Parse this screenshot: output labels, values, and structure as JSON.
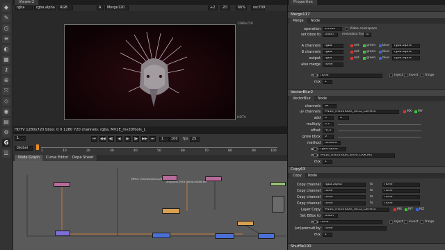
{
  "viewer": {
    "tab": "Viewer2",
    "channels": "rgba",
    "layer": "rgba.alpha",
    "colorspace": "RGB",
    "input_a": "A",
    "input_a_node": "Merge120",
    "gain": "+2",
    "mode": "2D",
    "zoom": "66%",
    "frame_cmp": "rec709",
    "pos_a": "0.5",
    "pos_b": "1",
    "format_label": "1280x720",
    "hdtv_label": "HDTV",
    "info": "HDTV 1280x720 bbox: 0 0 1280 720 channels: rgba, MV2E_mv20Tools_L"
  },
  "timeline": {
    "frame": "1",
    "fps_label": "fps",
    "fps": "25",
    "global": "Global",
    "tick_labels": [
      "1",
      "10",
      "20",
      "30",
      "40",
      "50",
      "60",
      "70",
      "80",
      "90",
      "100"
    ],
    "end": "100",
    "end_frame": "1"
  },
  "nodegraph": {
    "tabs": [
      "Node Graph",
      "Curve Editor",
      "Dope Sheet"
    ],
    "label_a": "MPEG: /mnt/sdc2/Linux/Data/...",
    "label_b": "/tmp/shot_v001_comp.####.exr"
  },
  "properties": {
    "title": "Properties",
    "panels": {
      "merge": {
        "name": "Merge117",
        "tabs": [
          "Merge",
          "Node"
        ],
        "operation_label": "operation",
        "operation": "screen",
        "video_colorspace": "Video colorspace",
        "bbox_label": "set bbox to",
        "bbox": "union",
        "metadata_label": "metadata from",
        "metadata": "B",
        "a_label": "A channels",
        "a_channels": "rgba",
        "b_label": "B channels",
        "b_channels": "rgba",
        "out_label": "output",
        "output": "rgba",
        "also_label": "also merge",
        "also": "none",
        "c_red": "red",
        "c_green": "green",
        "c_blue": "blue",
        "c_alpha": "rgba.alpha",
        "mask_label": "mask",
        "mask": "none",
        "inject": "inject",
        "invert": "invert",
        "fringe": "fringe",
        "mix_label": "mix",
        "mix": "1"
      },
      "vblur": {
        "name": "VectorBlur2",
        "tabs": [
          "VectorBlur",
          "Node"
        ],
        "channels_label": "channels",
        "channels": "all",
        "uv_label": "uv channels",
        "uv": "MV2E_mv20Tools_Sh15_camera",
        "mx": "MX",
        "my": "MY",
        "add_label": "add",
        "add_u": "0",
        "add_v": "0",
        "mult_label": "multiply",
        "multiply": "0.1",
        "offset_label": "offset",
        "offset": "-0.5",
        "grow_label": "grow bbox",
        "grow": "0",
        "method_label": "method",
        "method": "forward",
        "alpha_label": "alpha",
        "alpha": "rgba.alpha",
        "mask_label": "mask",
        "mask": "MV2E_mv20Tools_sh09_CAM.MX",
        "mix_label": "mix",
        "mix": "1"
      },
      "copy": {
        "name": "Copy63",
        "tabs": [
          "Copy",
          "Node"
        ],
        "copy_label": "Copy channel",
        "channels": [
          "rgba.alpha",
          "none",
          "none",
          "none"
        ],
        "to_label": "to",
        "targets": [
          "none",
          "none",
          "none",
          "none"
        ],
        "layer_label": "Layer Copy",
        "layer": "MV2E_mv20Tools_Sh15_camera",
        "mx": "MX",
        "my": "MY",
        "mz": "MZ",
        "bbox_label": "Set BBox to",
        "bbox": "union",
        "mask_label": "mask",
        "mask": "none",
        "unpremult_label": "(un)premult by",
        "unpremult": "none",
        "mix_label": "mix",
        "mix": "1",
        "inject": "inject",
        "invert": "invert",
        "fringe": "fringe"
      },
      "shuffle": {
        "name": "Shuffle100",
        "tabs": [
          "Shuffle",
          "Node"
        ]
      }
    }
  },
  "toolbar_icons": [
    "pointer-icon",
    "draw-icon",
    "time-icon",
    "channel-icon",
    "color-icon",
    "filter-icon",
    "keyer-icon",
    "merge-icon",
    "transform-icon",
    "3d-icon",
    "views-icon",
    "metadata-icon",
    "toolsets-icon",
    "other-icon",
    "furnace-icon"
  ],
  "colors": {
    "accent_orange": "#e8882a",
    "node_merge": "#4a6fd6",
    "node_blur": "#d8a050",
    "node_read": "#b86b9a",
    "node_copy": "#7c6fd6"
  }
}
